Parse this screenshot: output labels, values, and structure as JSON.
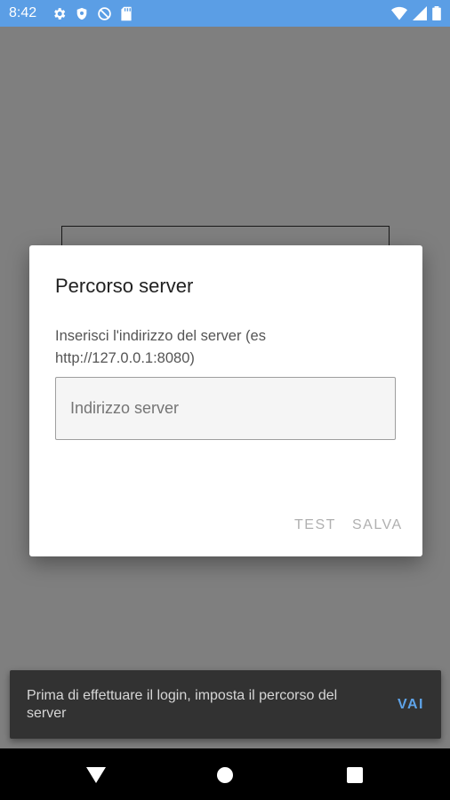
{
  "status_bar": {
    "time": "8:42",
    "background": "#5b9ee5",
    "icons_left": [
      "settings-icon",
      "shield-icon",
      "do-not-disturb-icon",
      "sd-card-icon"
    ],
    "icons_right": [
      "wifi-icon",
      "signal-icon",
      "battery-icon"
    ]
  },
  "dialog": {
    "title": "Percorso server",
    "message": "Inserisci l'indirizzo del server (es http://127.0.0.1:8080)",
    "input": {
      "value": "",
      "placeholder": "Indirizzo server"
    },
    "buttons": {
      "test": "TEST",
      "save": "SALVA"
    }
  },
  "snackbar": {
    "message": "Prima di effettuare il login, imposta il percorso del server",
    "action": "VAI",
    "action_color": "#5ea3e8"
  },
  "nav_bar": {
    "icons": [
      "back-icon",
      "home-icon",
      "recents-icon"
    ]
  }
}
